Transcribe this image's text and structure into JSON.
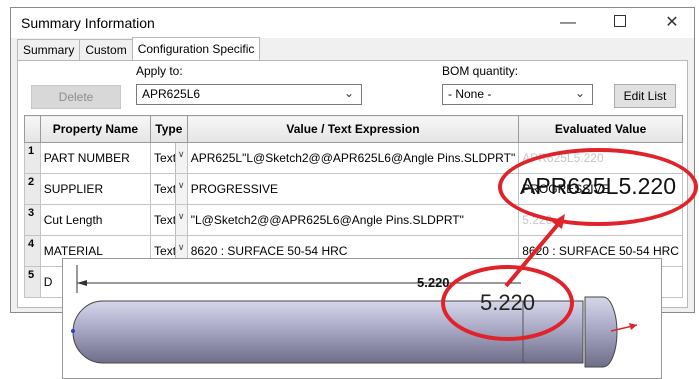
{
  "window": {
    "title": "Summary Information",
    "minimize_glyph": "—",
    "close_glyph": "✕"
  },
  "tabs": [
    {
      "label": "Summary"
    },
    {
      "label": "Custom"
    },
    {
      "label": "Configuration Specific",
      "active": true
    }
  ],
  "controls": {
    "delete_label": "Delete",
    "apply_to_label": "Apply to:",
    "apply_to_value": "APR625L6",
    "bom_label": "BOM quantity:",
    "bom_value": "- None -",
    "edit_list_label": "Edit List"
  },
  "table": {
    "headers": [
      "",
      "Property Name",
      "Type",
      "Value / Text Expression",
      "Evaluated Value"
    ],
    "rows": [
      {
        "num": "1",
        "name": "PART NUMBER",
        "type": "Text",
        "value": "APR625L\"L@Sketch2@@APR625L6@Angle Pins.SLDPRT\"",
        "evaluated": "APR625L5.220"
      },
      {
        "num": "2",
        "name": "SUPPLIER",
        "type": "Text",
        "value": "PROGRESSIVE",
        "evaluated": "PROGRESSIVE"
      },
      {
        "num": "3",
        "name": "Cut Length",
        "type": "Text",
        "value": "\"L@Sketch2@@APR625L6@Angle Pins.SLDPRT\"",
        "evaluated": "5.220"
      },
      {
        "num": "4",
        "name": "MATERIAL",
        "type": "Text",
        "value": "8620 : SURFACE 50-54 HRC",
        "evaluated": "8620 : SURFACE 50-54 HRC"
      },
      {
        "num": "5",
        "name": "D",
        "type": "",
        "value": "",
        "evaluated": ""
      }
    ]
  },
  "callouts": {
    "evaluated_zoom": "APR625L5.220",
    "dimension_zoom": "5.220"
  },
  "cad": {
    "dimension_label": "5.220"
  },
  "colors": {
    "callout": "#e0222a",
    "pin_body": "#a9a9c6",
    "arrow_red": "#e0222a"
  }
}
